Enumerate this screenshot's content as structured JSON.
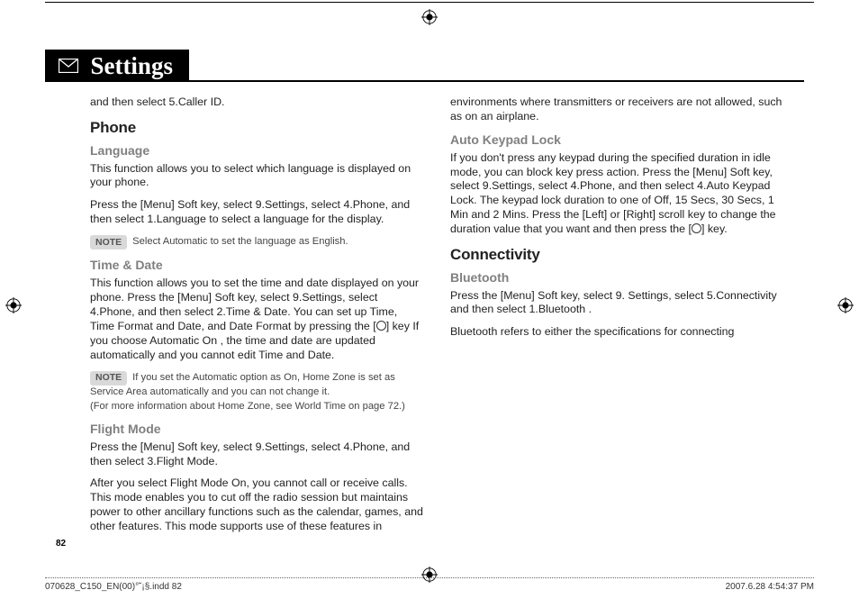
{
  "header": {
    "title": "Settings",
    "icon": "envelope-icon"
  },
  "page_number": "82",
  "footer": {
    "left": "070628_C150_EN(00)°˘¡§.indd   82",
    "right": "2007.6.28   4:54:37 PM"
  },
  "col1": {
    "intro_continued": "and then select 5.Caller ID.",
    "phone_heading": "Phone",
    "language_heading": "Language",
    "language_p1": "This function allows you to select which language is displayed on your phone.",
    "language_p2": "Press the [Menu] Soft key, select 9.Settings, select 4.Phone, and then select 1.Language to select a language for the display.",
    "note1_label": "NOTE",
    "note1_text": "Select Automatic to set the language as English.",
    "timedate_heading": "Time & Date",
    "timedate_p1a": "This function allows you to set the time and date displayed on your phone. Press the [Menu] Soft key, select 9.Settings, select 4.Phone, and then select 2.Time & Date. You can set up Time, Time Format and Date, and Date Format by pressing the [",
    "timedate_p1b": "] key If you choose Automatic On , the time and date are updated automatically and you cannot edit Time and Date.",
    "note2_label": "NOTE",
    "note2_text": "If you set the Automatic option as On, Home Zone is set as Service Area automatically and you can not change it.",
    "note2_extra": "(For more information about Home Zone, see World Time on page 72.)"
  },
  "col2": {
    "flight_heading": "Flight Mode",
    "flight_p1": "Press the [Menu] Soft key, select 9.Settings, select 4.Phone, and then select 3.Flight Mode.",
    "flight_p2": "After you select Flight Mode On, you cannot call or receive calls. This mode enables you to cut off the radio session but maintains power to other ancillary functions such as the calendar, games, and other features. This mode supports use of these features in environments where transmitters or receivers are not allowed, such as on an airplane.",
    "autokey_heading": "Auto Keypad Lock",
    "autokey_p1a": "If you don't press any keypad during the specified duration in idle mode, you can block key press action. Press the [Menu] Soft key, select 9.Settings, select 4.Phone, and then select 4.Auto Keypad Lock. The keypad lock duration to one of Off, 15 Secs, 30 Secs, 1 Min and 2 Mins. Press the [Left] or [Right] scroll key to change the duration value that you want and then press the [",
    "autokey_p1b": "] key.",
    "connectivity_heading": "Connectivity",
    "bluetooth_heading": "Bluetooth",
    "bluetooth_p1": "Press the [Menu] Soft key, select 9. Settings, select 5.Connectivity and then select 1.Bluetooth .",
    "bluetooth_p2": "Bluetooth refers to either the specifications for connecting"
  }
}
